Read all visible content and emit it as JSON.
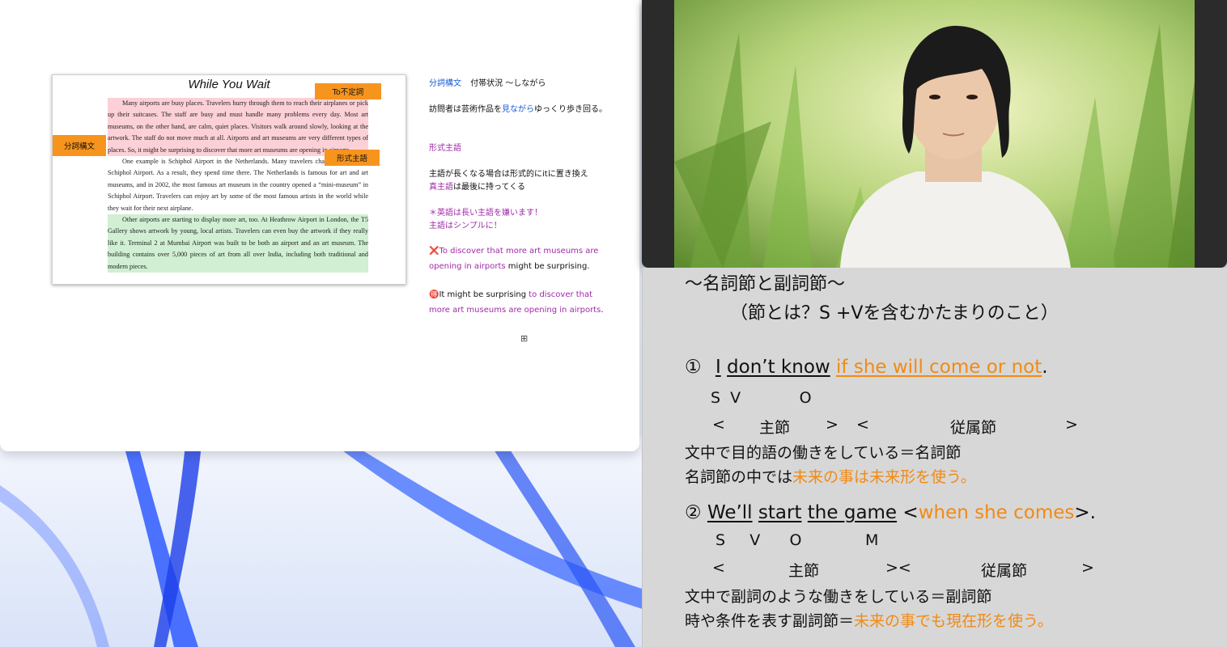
{
  "slide": {
    "title": "While You Wait",
    "tags": {
      "to_infinitive": "To不定詞",
      "participle": "分詞構文",
      "formal_subject": "形式主語"
    },
    "paragraphs": [
      "Many airports are busy places. Travelers hurry through them to reach their airplanes or pick up their suitcases. The staff are busy and must handle many problems every day. Most art museums, on the other hand, are calm, quiet places. Visitors walk around slowly, looking at the artwork. The staff do not move much at all. Airports and art museums are very different types of places. So, it might be surprising to discover that more art museums are opening in airports.",
      "One example is Schiphol Airport in the Netherlands. Many travelers change airplanes at Schiphol Airport. As a result, they spend time there. The Netherlands is famous for art and art museums, and in 2002, the most famous art museum in the country opened a “mini-museum” in Schiphol Airport. Travelers can enjoy art by some of the most famous artists in the world while they wait for their next airplane.",
      "Other airports are starting to display more art, too. At Heathrow Airport in London, the T5 Gallery shows artwork by young, local artists. Travelers can even buy the artwork if they really like it. Terminal 2 at Mumbai Airport was built to be both an airport and an art museum. The building contains over 5,000 pieces of art from all over India, including both traditional and modern pieces."
    ]
  },
  "notes": {
    "n1_label": "分詞構文",
    "n1_text": "付帯状況 〜しながら",
    "n2_pre": "訪問者は芸術作品を",
    "n2_hl": "見ながら",
    "n2_post": "ゆっくり歩き回る。",
    "n3": "形式主語",
    "n4": "主語が長くなる場合は形式的にitに置き換え",
    "n5_hl": "真主語",
    "n5_post": "は最後に持ってくる",
    "n6": "＊英語は長い主語を嫌います！",
    "n7": "主語はシンプルに！",
    "n8_mark": "❌",
    "n8_purple": "To discover that more art museums are",
    "n9_purple": "opening in airports",
    "n9_post": " might be surprising.",
    "n10_mark": "🉐",
    "n10_pre": "It might be surprising ",
    "n10_purple": "to discover that",
    "n11_purple": "more art museums are opening in airports",
    "n11_post": ".",
    "expand_icon": "⊞"
  },
  "lesson": {
    "title": "〜名詞節と副詞節〜",
    "subtitle": "（節とは？S +Vを含むかたまりのこと）",
    "ex1_num": "①",
    "ex1_s": "I",
    "ex1_v": "don’t know",
    "ex1_clause": "if she will come or not",
    "ex1_end": ".",
    "ex1_svo": "S  V            O",
    "ex1_bracket_open1": "<",
    "ex1_main": "主節",
    "ex1_bracket_close1": ">",
    "ex1_bracket_open2": "<",
    "ex1_sub": "従属節",
    "ex1_bracket_close2": ">",
    "ex1_note1": "文中で目的語の働きをしている＝名詞節",
    "ex1_note2_pre": "名詞節の中では",
    "ex1_note2_hl": "未来の事は未来形を使う。",
    "ex2_num": "②",
    "ex2_s": "We’ll",
    "ex2_v": "start",
    "ex2_o": "the game",
    "ex2_lt": "<",
    "ex2_clause": "when she comes",
    "ex2_end": ">.",
    "ex2_svom": "S     V      O             M",
    "ex2_bracket_open1": "<",
    "ex2_main": "主節",
    "ex2_bracket_mid": "><",
    "ex2_sub": "従属節",
    "ex2_bracket_close": ">",
    "ex2_note1": "文中で副詞のような働きをしている＝副詞節",
    "ex2_note2_pre": "時や条件を表す副詞節＝",
    "ex2_note2_hl": "未来の事でも現在形を使う。"
  },
  "colors": {
    "highlight_orange": "#f28a14",
    "tag_orange": "#f7941d",
    "note_blue": "#1a5bd6",
    "note_purple": "#a12aa8",
    "lesson_bg": "#d7d7d7"
  }
}
